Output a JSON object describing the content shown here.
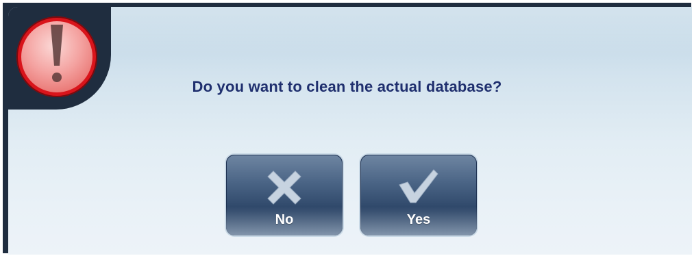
{
  "dialog": {
    "icon": "exclamation-warning-icon",
    "message": "Do you want to clean the actual database?",
    "buttons": {
      "no": {
        "label": "No",
        "icon": "x-cross-icon"
      },
      "yes": {
        "label": "Yes",
        "icon": "checkmark-icon"
      }
    }
  },
  "colors": {
    "alert_red": "#d9141b",
    "message_text": "#1f2f6e",
    "button_dark": "#233a5b",
    "frame_dark": "#1f2d3f"
  }
}
